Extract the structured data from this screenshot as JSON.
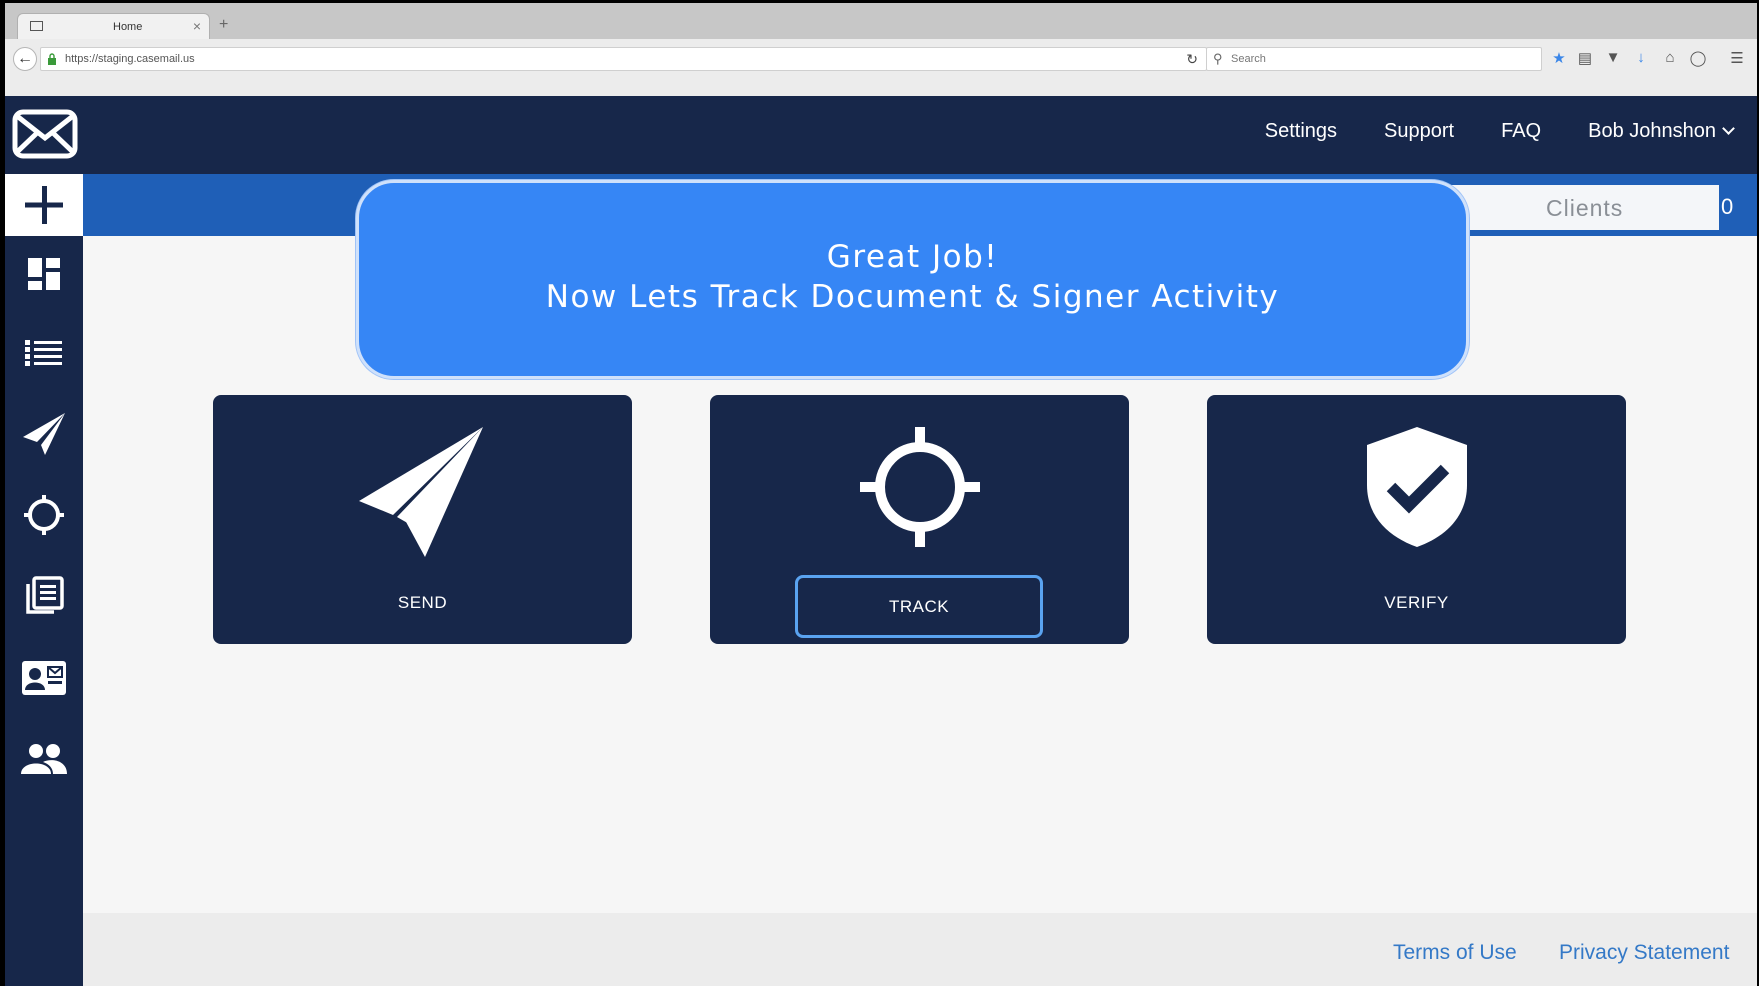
{
  "browser": {
    "tab_title": "Home",
    "tab_close": "×",
    "new_tab": "+",
    "url": "https://staging.casemail.us",
    "search_placeholder": "Search"
  },
  "header": {
    "nav": [
      {
        "label": "Settings"
      },
      {
        "label": "Support"
      },
      {
        "label": "FAQ"
      },
      {
        "label": "Bob Johnshon"
      }
    ]
  },
  "subheader": {
    "clients_label": "Clients",
    "edge_digit": "0"
  },
  "sidebar": {
    "items": [
      {
        "icon": "plus-icon"
      },
      {
        "icon": "dashboard-icon"
      },
      {
        "icon": "list-icon"
      },
      {
        "icon": "paper-plane-icon"
      },
      {
        "icon": "crosshair-icon"
      },
      {
        "icon": "documents-icon"
      },
      {
        "icon": "contact-card-icon"
      },
      {
        "icon": "users-icon"
      }
    ]
  },
  "tooltip": {
    "line1": "Great Job!",
    "line2": "Now Lets Track Document & Signer Activity"
  },
  "cards": {
    "send": "SEND",
    "track": "TRACK",
    "verify": "VERIFY"
  },
  "footer": {
    "terms": "Terms of Use",
    "privacy": "Privacy Statement"
  },
  "colors": {
    "navy": "#17274a",
    "subheader_blue": "#1f5fb7",
    "tooltip_blue": "#3686f5",
    "link_blue": "#3479c7"
  }
}
